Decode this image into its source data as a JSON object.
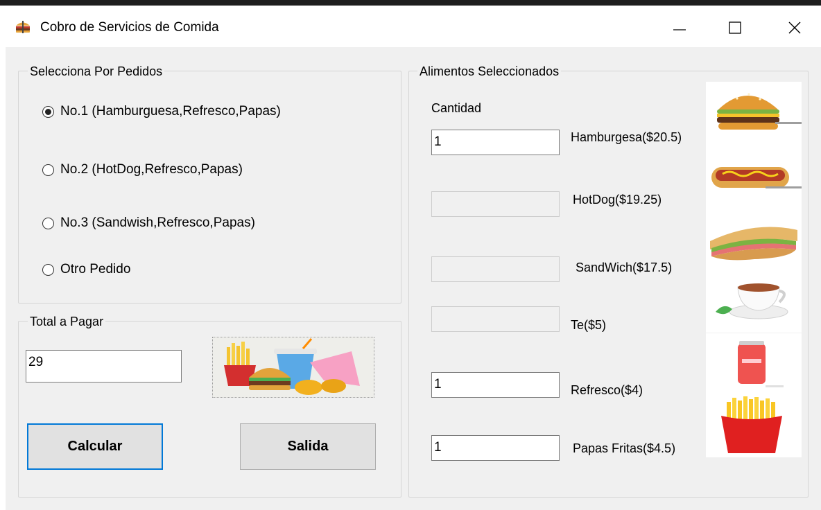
{
  "window": {
    "title": "Cobro de Servicios de Comida",
    "icon": "burger-app-icon",
    "controls": [
      "minimize-icon",
      "maximize-icon",
      "close-icon"
    ]
  },
  "pedidos": {
    "legend": "Selecciona Por Pedidos",
    "options": [
      {
        "label": "No.1 (Hamburguesa,Refresco,Papas)",
        "checked": true
      },
      {
        "label": "No.2 (HotDog,Refresco,Papas)",
        "checked": false
      },
      {
        "label": "No.3 (Sandwish,Refresco,Papas)",
        "checked": false
      },
      {
        "label": "Otro Pedido",
        "checked": false
      }
    ]
  },
  "total": {
    "legend": "Total a Pagar",
    "value": "29",
    "image": "fast-food-combo-image"
  },
  "buttons": {
    "calcular": "Calcular",
    "salida": "Salida"
  },
  "alimentos": {
    "legend": "Alimentos Seleccionados",
    "cantidad_label": "Cantidad",
    "items": [
      {
        "label": "Hamburgesa($20.5)",
        "value": "1",
        "enabled": true,
        "icon": "hamburger-icon"
      },
      {
        "label": "HotDog($19.25)",
        "value": "",
        "enabled": false,
        "icon": "hotdog-icon"
      },
      {
        "label": "SandWich($17.5)",
        "value": "",
        "enabled": false,
        "icon": "sandwich-icon"
      },
      {
        "label": "Te($5)",
        "value": "",
        "enabled": false,
        "icon": "tea-cup-icon"
      },
      {
        "label": "Refresco($4)",
        "value": "1",
        "enabled": true,
        "icon": "soda-can-icon"
      },
      {
        "label": "Papas Fritas($4.5)",
        "value": "1",
        "enabled": true,
        "icon": "french-fries-icon"
      }
    ]
  },
  "colors": {
    "accent": "#0078d7",
    "client_bg": "#f0f0f0"
  }
}
